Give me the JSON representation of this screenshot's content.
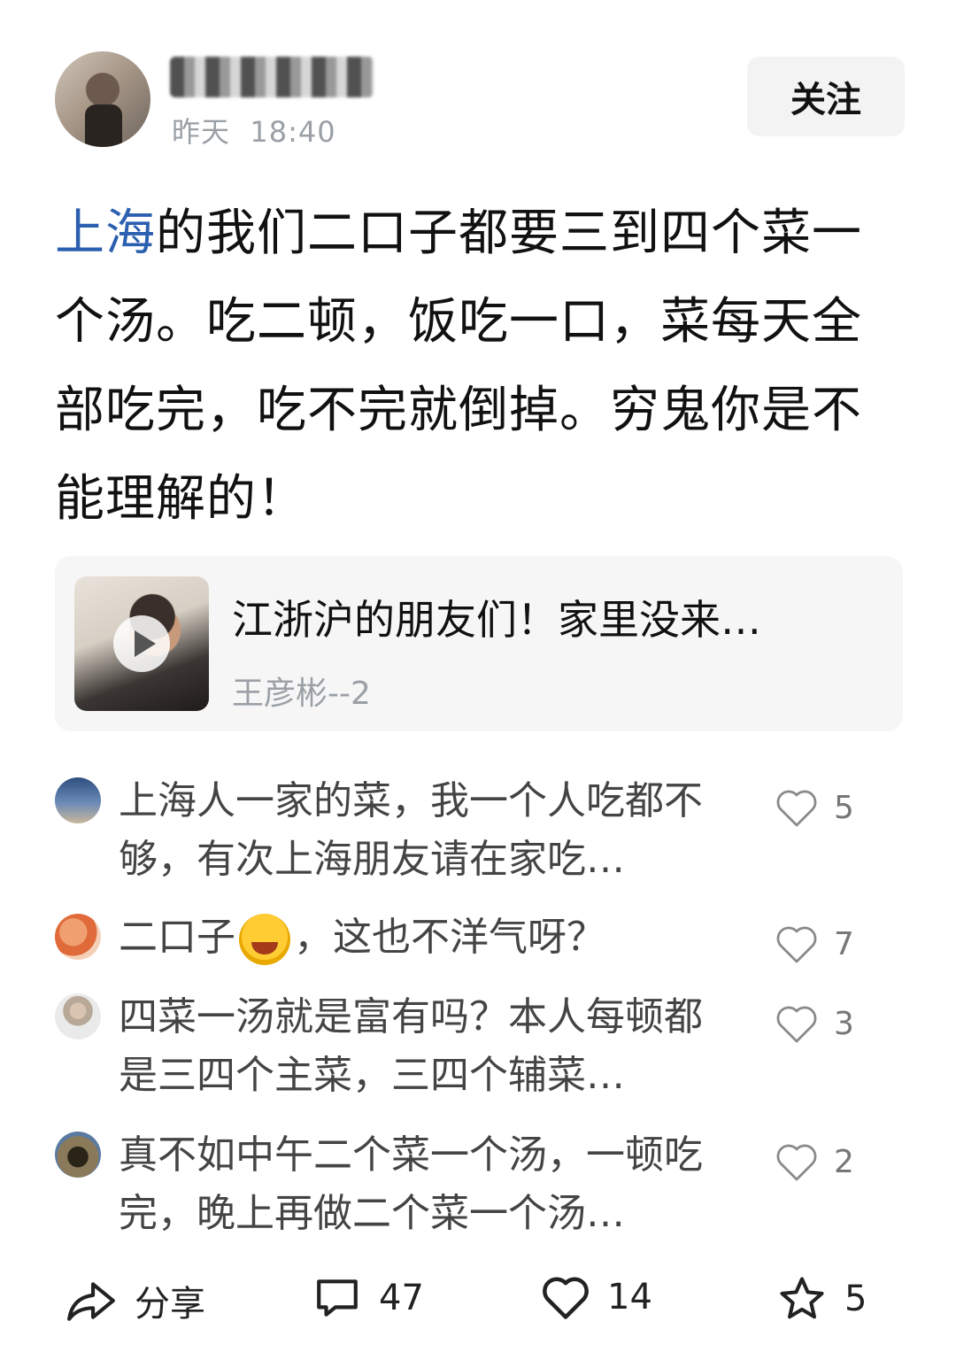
{
  "header": {
    "timestamp_day": "昨天",
    "timestamp_time": "18:40",
    "follow_label": "关注"
  },
  "post": {
    "link_text": "上海",
    "body_text": "的我们二口子都要三到四个菜一个汤。吃二顿，饭吃一口，菜每天全部吃完，吃不完就倒掉。穷鬼你是不能理解的！"
  },
  "video_card": {
    "title": "江浙沪的朋友们！家里没来…",
    "author": "王彦彬--2",
    "play_icon": "play-icon"
  },
  "comments": [
    {
      "text": "上海人一家的菜，我一个人吃都不够，有次上海朋友请在家吃…",
      "likes": "5",
      "avatar_color": "#4a6a9a"
    },
    {
      "text_before": "二口子",
      "text_after": "，这也不洋气呀？",
      "emoji": "laughing-crying-emoji",
      "likes": "7",
      "avatar_color": "#e07a4a"
    },
    {
      "text": "四菜一汤就是富有吗？本人每顿都是三四个主菜，三四个辅菜…",
      "likes": "3",
      "avatar_color": "#8a8a8a"
    },
    {
      "text": "真不如中午二个菜一个汤，一顿吃完，晚上再做二个菜一个汤…",
      "likes": "2",
      "avatar_color": "#6b5a3a"
    }
  ],
  "bottom_bar": {
    "share_label": "分享",
    "comment_count": "47",
    "like_count": "14",
    "favorite_count": "5"
  },
  "colors": {
    "link": "#2b5fb0",
    "muted": "#9aa0a6",
    "card_bg": "#f6f6f6"
  }
}
